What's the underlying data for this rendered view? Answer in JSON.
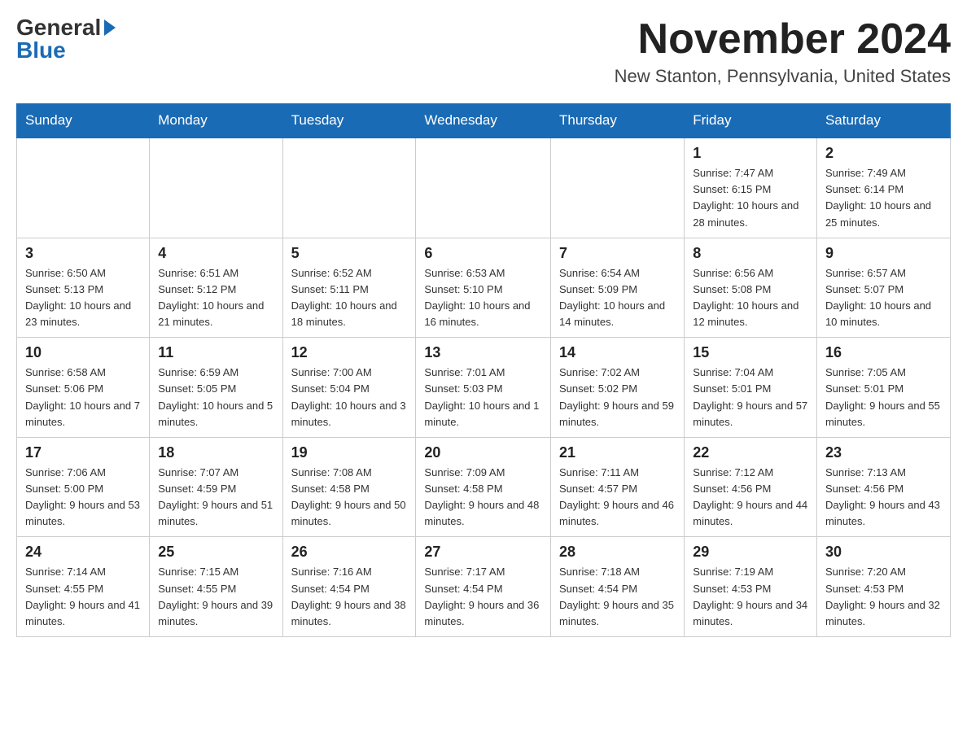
{
  "header": {
    "logo_general": "General",
    "logo_blue": "Blue",
    "month_year": "November 2024",
    "location": "New Stanton, Pennsylvania, United States"
  },
  "days_of_week": [
    "Sunday",
    "Monday",
    "Tuesday",
    "Wednesday",
    "Thursday",
    "Friday",
    "Saturday"
  ],
  "weeks": [
    [
      {
        "day": "",
        "sunrise": "",
        "sunset": "",
        "daylight": ""
      },
      {
        "day": "",
        "sunrise": "",
        "sunset": "",
        "daylight": ""
      },
      {
        "day": "",
        "sunrise": "",
        "sunset": "",
        "daylight": ""
      },
      {
        "day": "",
        "sunrise": "",
        "sunset": "",
        "daylight": ""
      },
      {
        "day": "",
        "sunrise": "",
        "sunset": "",
        "daylight": ""
      },
      {
        "day": "1",
        "sunrise": "Sunrise: 7:47 AM",
        "sunset": "Sunset: 6:15 PM",
        "daylight": "Daylight: 10 hours and 28 minutes."
      },
      {
        "day": "2",
        "sunrise": "Sunrise: 7:49 AM",
        "sunset": "Sunset: 6:14 PM",
        "daylight": "Daylight: 10 hours and 25 minutes."
      }
    ],
    [
      {
        "day": "3",
        "sunrise": "Sunrise: 6:50 AM",
        "sunset": "Sunset: 5:13 PM",
        "daylight": "Daylight: 10 hours and 23 minutes."
      },
      {
        "day": "4",
        "sunrise": "Sunrise: 6:51 AM",
        "sunset": "Sunset: 5:12 PM",
        "daylight": "Daylight: 10 hours and 21 minutes."
      },
      {
        "day": "5",
        "sunrise": "Sunrise: 6:52 AM",
        "sunset": "Sunset: 5:11 PM",
        "daylight": "Daylight: 10 hours and 18 minutes."
      },
      {
        "day": "6",
        "sunrise": "Sunrise: 6:53 AM",
        "sunset": "Sunset: 5:10 PM",
        "daylight": "Daylight: 10 hours and 16 minutes."
      },
      {
        "day": "7",
        "sunrise": "Sunrise: 6:54 AM",
        "sunset": "Sunset: 5:09 PM",
        "daylight": "Daylight: 10 hours and 14 minutes."
      },
      {
        "day": "8",
        "sunrise": "Sunrise: 6:56 AM",
        "sunset": "Sunset: 5:08 PM",
        "daylight": "Daylight: 10 hours and 12 minutes."
      },
      {
        "day": "9",
        "sunrise": "Sunrise: 6:57 AM",
        "sunset": "Sunset: 5:07 PM",
        "daylight": "Daylight: 10 hours and 10 minutes."
      }
    ],
    [
      {
        "day": "10",
        "sunrise": "Sunrise: 6:58 AM",
        "sunset": "Sunset: 5:06 PM",
        "daylight": "Daylight: 10 hours and 7 minutes."
      },
      {
        "day": "11",
        "sunrise": "Sunrise: 6:59 AM",
        "sunset": "Sunset: 5:05 PM",
        "daylight": "Daylight: 10 hours and 5 minutes."
      },
      {
        "day": "12",
        "sunrise": "Sunrise: 7:00 AM",
        "sunset": "Sunset: 5:04 PM",
        "daylight": "Daylight: 10 hours and 3 minutes."
      },
      {
        "day": "13",
        "sunrise": "Sunrise: 7:01 AM",
        "sunset": "Sunset: 5:03 PM",
        "daylight": "Daylight: 10 hours and 1 minute."
      },
      {
        "day": "14",
        "sunrise": "Sunrise: 7:02 AM",
        "sunset": "Sunset: 5:02 PM",
        "daylight": "Daylight: 9 hours and 59 minutes."
      },
      {
        "day": "15",
        "sunrise": "Sunrise: 7:04 AM",
        "sunset": "Sunset: 5:01 PM",
        "daylight": "Daylight: 9 hours and 57 minutes."
      },
      {
        "day": "16",
        "sunrise": "Sunrise: 7:05 AM",
        "sunset": "Sunset: 5:01 PM",
        "daylight": "Daylight: 9 hours and 55 minutes."
      }
    ],
    [
      {
        "day": "17",
        "sunrise": "Sunrise: 7:06 AM",
        "sunset": "Sunset: 5:00 PM",
        "daylight": "Daylight: 9 hours and 53 minutes."
      },
      {
        "day": "18",
        "sunrise": "Sunrise: 7:07 AM",
        "sunset": "Sunset: 4:59 PM",
        "daylight": "Daylight: 9 hours and 51 minutes."
      },
      {
        "day": "19",
        "sunrise": "Sunrise: 7:08 AM",
        "sunset": "Sunset: 4:58 PM",
        "daylight": "Daylight: 9 hours and 50 minutes."
      },
      {
        "day": "20",
        "sunrise": "Sunrise: 7:09 AM",
        "sunset": "Sunset: 4:58 PM",
        "daylight": "Daylight: 9 hours and 48 minutes."
      },
      {
        "day": "21",
        "sunrise": "Sunrise: 7:11 AM",
        "sunset": "Sunset: 4:57 PM",
        "daylight": "Daylight: 9 hours and 46 minutes."
      },
      {
        "day": "22",
        "sunrise": "Sunrise: 7:12 AM",
        "sunset": "Sunset: 4:56 PM",
        "daylight": "Daylight: 9 hours and 44 minutes."
      },
      {
        "day": "23",
        "sunrise": "Sunrise: 7:13 AM",
        "sunset": "Sunset: 4:56 PM",
        "daylight": "Daylight: 9 hours and 43 minutes."
      }
    ],
    [
      {
        "day": "24",
        "sunrise": "Sunrise: 7:14 AM",
        "sunset": "Sunset: 4:55 PM",
        "daylight": "Daylight: 9 hours and 41 minutes."
      },
      {
        "day": "25",
        "sunrise": "Sunrise: 7:15 AM",
        "sunset": "Sunset: 4:55 PM",
        "daylight": "Daylight: 9 hours and 39 minutes."
      },
      {
        "day": "26",
        "sunrise": "Sunrise: 7:16 AM",
        "sunset": "Sunset: 4:54 PM",
        "daylight": "Daylight: 9 hours and 38 minutes."
      },
      {
        "day": "27",
        "sunrise": "Sunrise: 7:17 AM",
        "sunset": "Sunset: 4:54 PM",
        "daylight": "Daylight: 9 hours and 36 minutes."
      },
      {
        "day": "28",
        "sunrise": "Sunrise: 7:18 AM",
        "sunset": "Sunset: 4:54 PM",
        "daylight": "Daylight: 9 hours and 35 minutes."
      },
      {
        "day": "29",
        "sunrise": "Sunrise: 7:19 AM",
        "sunset": "Sunset: 4:53 PM",
        "daylight": "Daylight: 9 hours and 34 minutes."
      },
      {
        "day": "30",
        "sunrise": "Sunrise: 7:20 AM",
        "sunset": "Sunset: 4:53 PM",
        "daylight": "Daylight: 9 hours and 32 minutes."
      }
    ]
  ]
}
